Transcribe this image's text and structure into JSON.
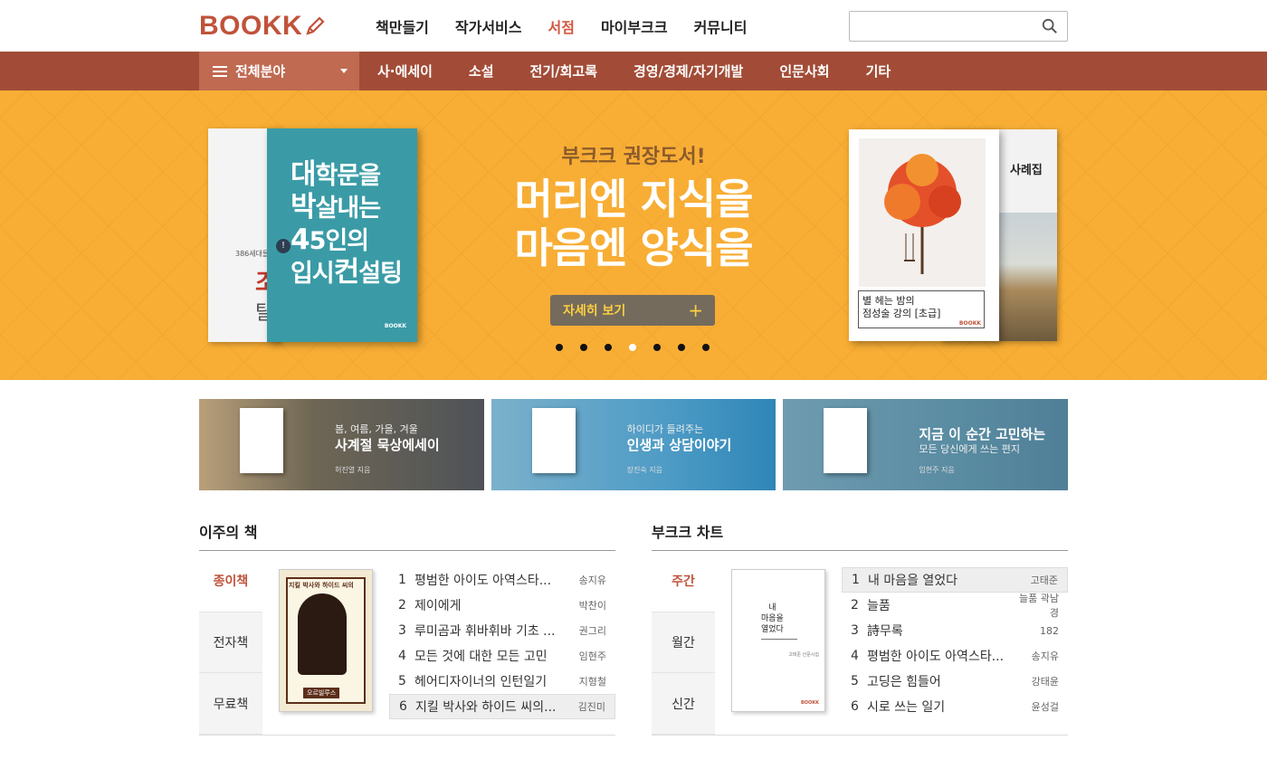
{
  "brand": {
    "logo": "BOOKK",
    "accent": "#c0533a",
    "catbar_color": "#a24c37",
    "banner_color": "#f8ae35"
  },
  "topnav": [
    "책만들기",
    "작가서비스",
    "서점",
    "마이부크크",
    "커뮤니티"
  ],
  "topnav_active": "서점",
  "search": {
    "placeholder": "",
    "icon": "search-icon"
  },
  "category": {
    "all_label": "전체분야",
    "items": [
      "사·에세이",
      "소설",
      "전기/회고록",
      "경영/경제/자기개발",
      "인문사회",
      "기타"
    ]
  },
  "banner": {
    "subtitle": "부크크 권장도서!",
    "title_line1": "머리엔 지식을",
    "title_line2": "마음엔 양식을",
    "button_label": "자세히 보기",
    "dots_count": 7,
    "active_dot": 4,
    "left_book": {
      "line1_big": "대",
      "line1": "학문을",
      "line2_big": "박",
      "line2": "살내는",
      "line3_big": "4",
      "line3": "5인의",
      "line4": "입시",
      "line4_big": "컨",
      "line4_end": "설팅",
      "back_small": "386세대들",
      "back_red": "조",
      "back_gray": "탈",
      "publisher": "BOOKK"
    },
    "right_book": {
      "title_line1": "별 헤는 밤의",
      "title_line2": "점성술 강의 [초급]",
      "back_title": "사례집",
      "publisher": "BOOKK"
    }
  },
  "promos": [
    {
      "line1": "봄, 여름, 가을, 겨울",
      "line2": "사계절 묵상에세이",
      "author": "허진열 지음"
    },
    {
      "line1": "하이디가 들려주는",
      "line2": "인생과 상담이야기",
      "author": "장진숙 지음"
    },
    {
      "line1": "지금 이 순간 고민하는",
      "line2": "모든 당신에게 쓰는 편지",
      "author": "임현주 지음"
    }
  ],
  "weekly": {
    "heading": "이주의 책",
    "tabs": [
      "종이책",
      "전자책",
      "무료책"
    ],
    "active_tab": 0,
    "cover": {
      "title": "지킬 박사와 하이드 씨의",
      "badge": "오르빌루스"
    },
    "books": [
      {
        "num": "1",
        "title": "평범한 아이도 아역스타...",
        "author": "송지유"
      },
      {
        "num": "2",
        "title": "제이에게",
        "author": "박찬이"
      },
      {
        "num": "3",
        "title": "루미곰과 휘바휘바 기초 ...",
        "author": "권그리"
      },
      {
        "num": "4",
        "title": "모든 것에 대한 모든 고민",
        "author": "임현주"
      },
      {
        "num": "5",
        "title": "헤어디자이너의 인턴일기",
        "author": "지형철"
      },
      {
        "num": "6",
        "title": "지킬 박사와 하이드 씨의...",
        "author": "김진미"
      }
    ],
    "selected": 5
  },
  "chart": {
    "heading": "부크크 차트",
    "tabs": [
      "주간",
      "월간",
      "신간"
    ],
    "active_tab": 0,
    "cover": {
      "title_l1": "내",
      "title_l2": "마음을",
      "title_l3": "열었다",
      "author": "고태준 산문시집",
      "publisher": "BOOKK"
    },
    "books": [
      {
        "num": "1",
        "title": "내 마음을 열었다",
        "author": "고태준"
      },
      {
        "num": "2",
        "title": "늘품",
        "author": "늘품 곽남경"
      },
      {
        "num": "3",
        "title": "詩무록",
        "author": "182"
      },
      {
        "num": "4",
        "title": "평범한 아이도 아역스타...",
        "author": "송지유"
      },
      {
        "num": "5",
        "title": "고딩은 힘들어",
        "author": "강태윤"
      },
      {
        "num": "6",
        "title": "시로 쓰는 일기",
        "author": "윤성걸"
      }
    ],
    "selected": 0
  }
}
